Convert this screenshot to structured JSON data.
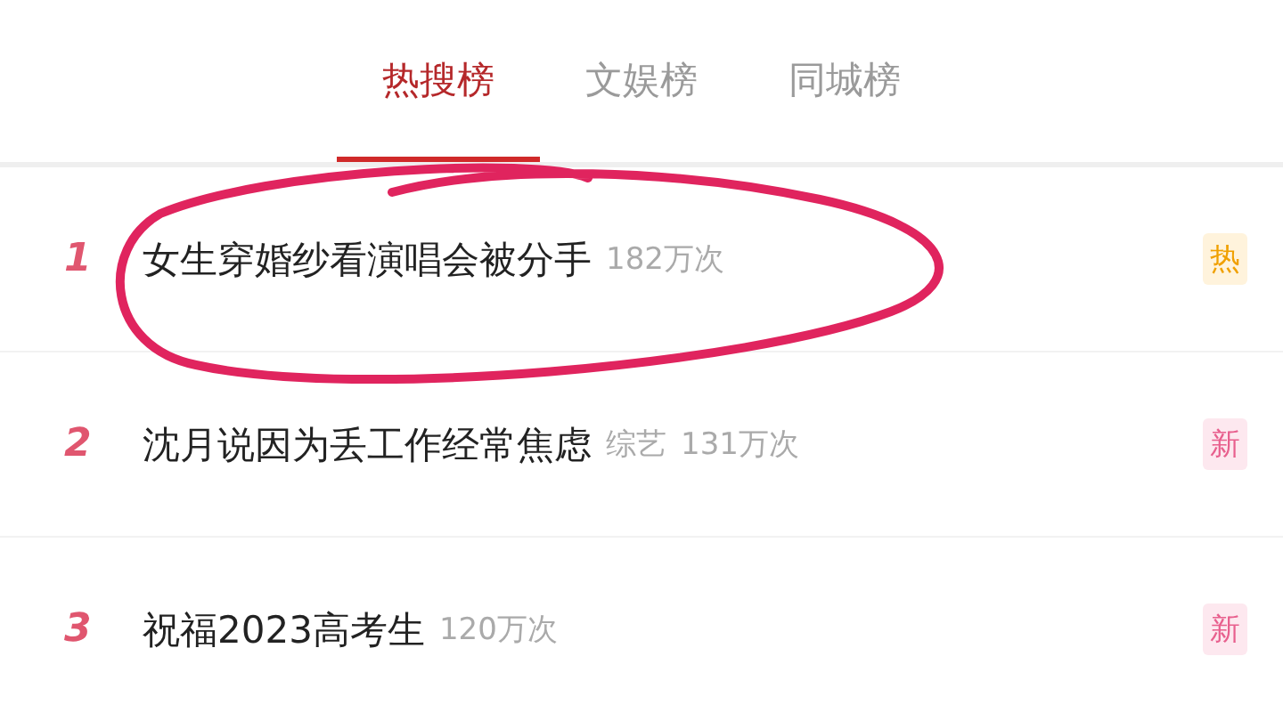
{
  "tabs": [
    {
      "label": "热搜榜",
      "selected": true
    },
    {
      "label": "文娱榜",
      "selected": false
    },
    {
      "label": "同城榜",
      "selected": false
    }
  ],
  "rows": [
    {
      "rank": "1",
      "title": "女生穿婚纱看演唱会被分手",
      "views": "182万次",
      "badge": {
        "kind": "hot",
        "label": "热"
      },
      "circled": true
    },
    {
      "rank": "2",
      "title": "沈月说因为丢工作经常焦虑",
      "category": "综艺",
      "views": "131万次",
      "badge": {
        "kind": "new",
        "label": "新"
      },
      "circled": false
    },
    {
      "rank": "3",
      "title": "祝福2023高考生",
      "views": "120万次",
      "badge": {
        "kind": "new",
        "label": "新"
      },
      "circled": false
    }
  ]
}
